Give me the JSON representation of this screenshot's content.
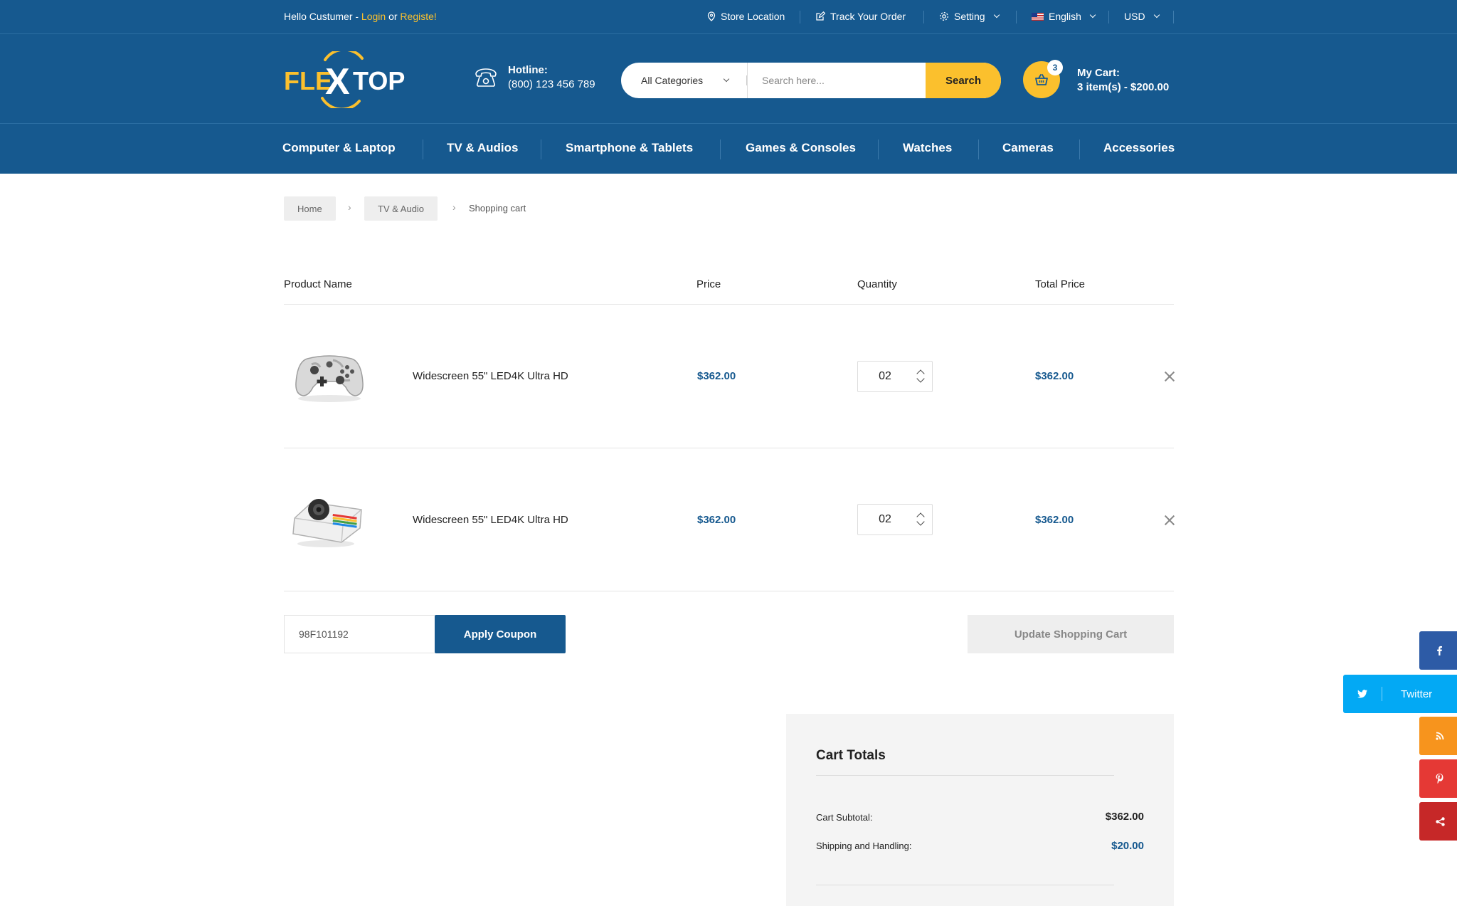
{
  "topbar": {
    "greeting": "Hello Custumer - ",
    "login": "Login",
    "or": " or ",
    "register": "Registe!",
    "store_location": "Store Location",
    "track_order": "Track Your Order",
    "setting": "Setting",
    "language": "English",
    "currency": "USD"
  },
  "header": {
    "logo_left": "FLE",
    "logo_x": "X",
    "logo_right": "TOP",
    "hotline_label": "Hotline:",
    "hotline_number": "(800) 123 456 789",
    "search_category": "All Categories",
    "search_placeholder": "Search here...",
    "search_button": "Search",
    "cart_count": "3",
    "cart_label": "My Cart:",
    "cart_summary": "3 item(s) - $200.00"
  },
  "nav": {
    "items": [
      "Computer & Laptop",
      "TV & Audios",
      "Smartphone & Tablets",
      "Games & Consoles",
      "Watches",
      "Cameras",
      "Accessories"
    ]
  },
  "breadcrumb": {
    "home": "Home",
    "category": "TV & Audio",
    "current": "Shopping cart"
  },
  "table": {
    "headers": {
      "product": "Product Name",
      "price": "Price",
      "quantity": "Quantity",
      "total": "Total Price"
    },
    "rows": [
      {
        "image": "gamepad-controller",
        "name": "Widescreen 55\" LED4K Ultra HD",
        "price": "$362.00",
        "quantity": "02",
        "total": "$362.00"
      },
      {
        "image": "instant-camera",
        "name": "Widescreen 55\" LED4K Ultra HD",
        "price": "$362.00",
        "quantity": "02",
        "total": "$362.00"
      }
    ]
  },
  "coupon": {
    "code": "98F101192",
    "apply_button": "Apply Coupon",
    "update_button": "Update Shopping Cart"
  },
  "totals": {
    "title": "Cart Totals",
    "subtotal_label": "Cart Subtotal:",
    "subtotal_value": "$362.00",
    "shipping_label": "Shipping and Handling:",
    "shipping_value": "$20.00"
  },
  "social": {
    "twitter_label": "Twitter",
    "colors": {
      "facebook": "#2d5ba6",
      "twitter": "#03a9f4",
      "rss": "#f7941d",
      "pinterest": "#e53935",
      "share": "#c62828"
    }
  },
  "colors": {
    "brand_blue": "#16598f",
    "accent_yellow": "#fbc02d"
  }
}
